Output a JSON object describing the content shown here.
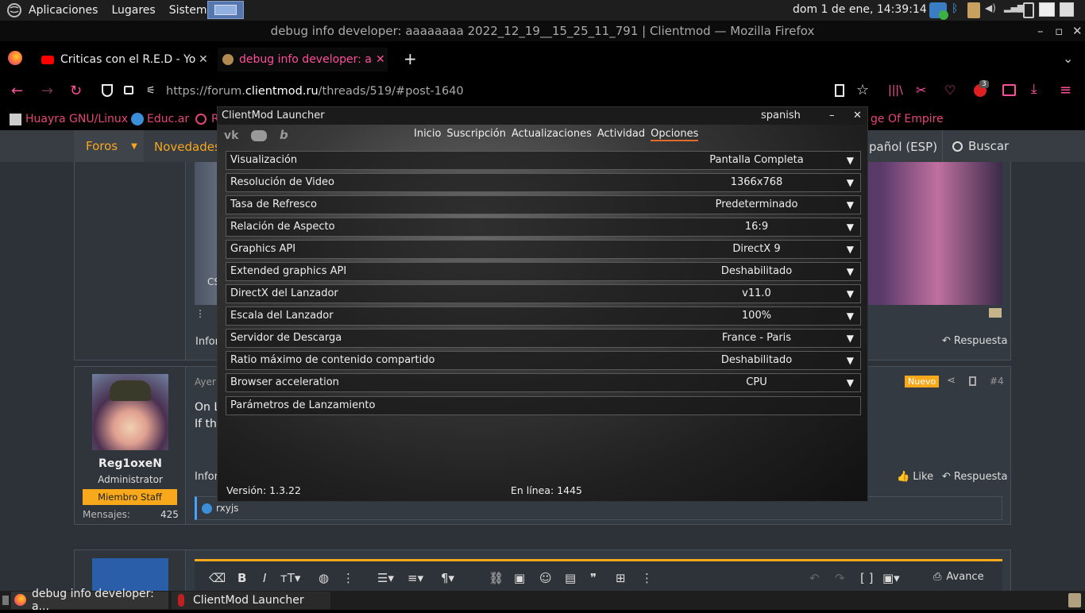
{
  "panel": {
    "menu": [
      "Aplicaciones",
      "Lugares",
      "Sistema"
    ],
    "clock": "dom  1 de ene, 14:39:14"
  },
  "firefox": {
    "title": "debug info developer: aaaaaaaa 2022_12_19__15_25_11_791 | Clientmod — Mozilla Firefox",
    "tabs": [
      {
        "label": "Criticas con el R.E.D - YouTube"
      },
      {
        "label": "debug info developer: aaaaaaaa"
      }
    ],
    "url_prefix": "https://forum.",
    "url_domain": "clientmod.ru",
    "url_path": "/threads/519/#post-1640",
    "badge": "3",
    "bookmarks": [
      "Huayra GNU/Linux",
      "Educ.ar",
      "R",
      "ge Of Empire"
    ]
  },
  "forum": {
    "nav": {
      "forums": "Foros",
      "news": "Novedades",
      "language": "pañol (ESP)",
      "search": "Buscar"
    },
    "post1": {
      "caption": "CS",
      "info": "Infor",
      "reply": "Respuesta"
    },
    "post2": {
      "date": "Ayer a",
      "new_badge": "Nuevo",
      "number": "#4",
      "line1": "On L",
      "line2": "If the",
      "user": "Reg1oxeN",
      "role": "Administrator",
      "staff": "Miembro Staff",
      "msgs_label": "Mensajes:",
      "msgs_value": "425",
      "info": "Infor",
      "like": "Like",
      "reply": "Respuesta",
      "likers": "rxyjs"
    },
    "editor": {
      "preview": "Avance"
    }
  },
  "launcher": {
    "title": "ClientMod Launcher",
    "language": "spanish",
    "menu": [
      "Inicio",
      "Suscripción",
      "Actualizaciones",
      "Actividad",
      "Opciones"
    ],
    "options": [
      {
        "label": "Visualización",
        "value": "Pantalla Completa"
      },
      {
        "label": "Resolución de Video",
        "value": "1366x768"
      },
      {
        "label": "Tasa de Refresco",
        "value": "Predeterminado"
      },
      {
        "label": "Relación de Aspecto",
        "value": "16:9"
      },
      {
        "label": "Graphics API",
        "value": "DirectX 9"
      },
      {
        "label": "Extended graphics API",
        "value": "Deshabilitado"
      },
      {
        "label": "DirectX del Lanzador",
        "value": "v11.0"
      },
      {
        "label": "Escala del Lanzador",
        "value": "100%"
      },
      {
        "label": "Servidor de Descarga",
        "value": "France - Paris"
      },
      {
        "label": "Ratio máximo de contenido compartido",
        "value": "Deshabilitado"
      },
      {
        "label": "Browser acceleration",
        "value": "CPU"
      }
    ],
    "params_label": "Parámetros de Lanzamiento",
    "version": "Versión: 1.3.22",
    "online": "En línea: 1445"
  },
  "taskbar": {
    "items": [
      "debug info developer: a...",
      "ClientMod Launcher"
    ]
  },
  "colors": {
    "accent_orange": "#f7a81b",
    "launcher_active": "#e06a2a",
    "ff_pink": "#ff4f9b"
  }
}
